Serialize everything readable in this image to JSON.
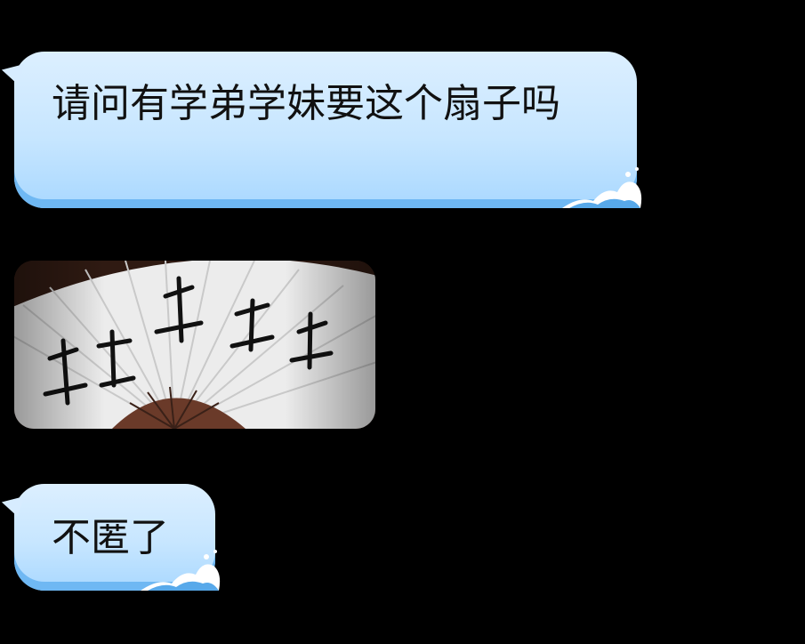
{
  "messages": [
    {
      "type": "text",
      "text": "请问有学弟学妹要这个扇子吗"
    },
    {
      "type": "image",
      "icon": "folding-fan-image",
      "calligraphy": "千孤剑道松"
    },
    {
      "type": "text",
      "text": "不匿了"
    }
  ],
  "colors": {
    "background": "#000000",
    "bubble_top": "#dcefff",
    "bubble_bottom": "#a9d8ff",
    "bubble_edge": "#6fb8f3",
    "fan_paper": "#f2f2f2",
    "fan_ribs": "#6a3a29"
  }
}
